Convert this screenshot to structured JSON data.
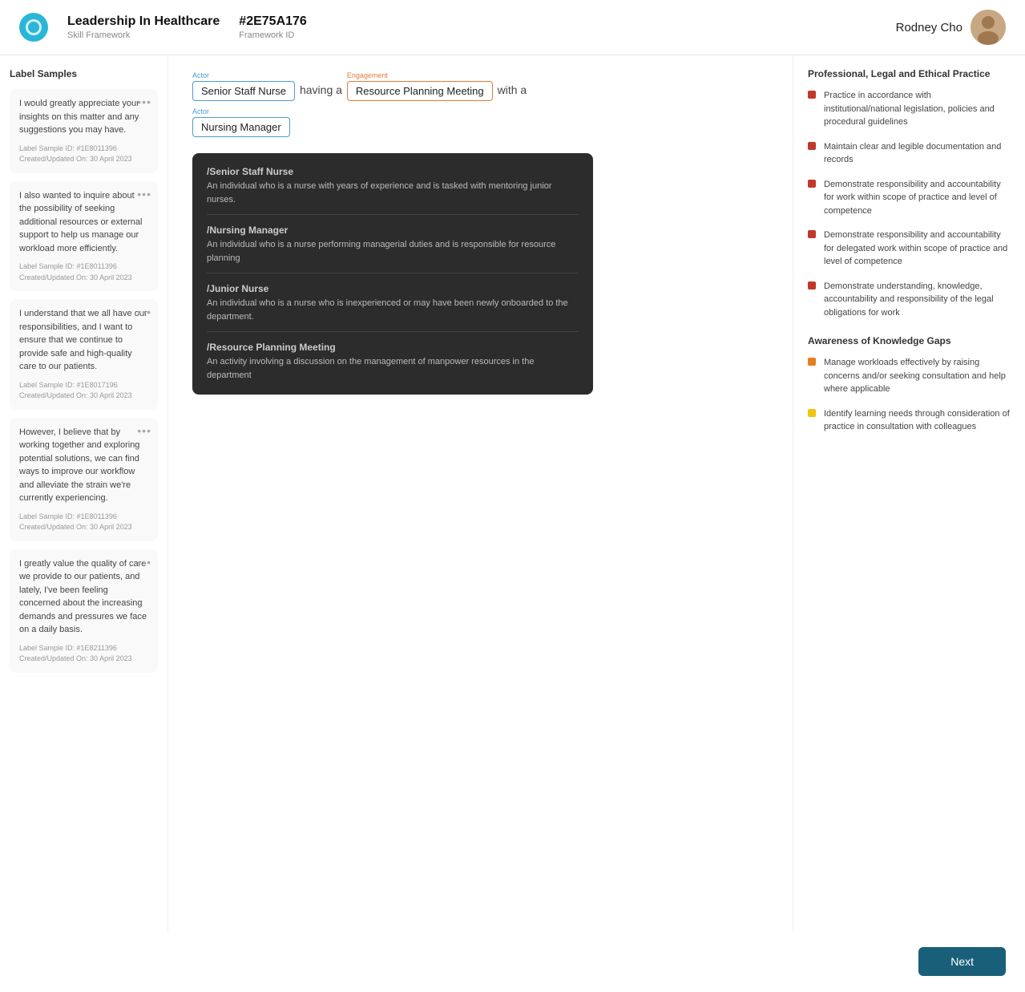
{
  "header": {
    "logo_alt": "Leadership In Healthcare logo",
    "title": "Leadership In Healthcare",
    "subtitle": "Skill Framework",
    "framework_id": "#2E75A176",
    "framework_id_label": "Framework ID",
    "username": "Rodney Cho"
  },
  "left_panel": {
    "section_title": "Label Samples",
    "samples": [
      {
        "text": "I would greatly appreciate your insights on this matter and any suggestions you may have.",
        "id_label": "Label Sample ID: #1E8011396",
        "created_label": "Created/Updated On: 30 April 2023"
      },
      {
        "text": "I also wanted to inquire about the possibility of seeking additional resources or external support to help us manage our workload more efficiently.",
        "id_label": "Label Sample ID: #1E8011396",
        "created_label": "Created/Updated On: 30 April 2023"
      },
      {
        "text": "I understand that we all have our responsibilities, and I want to ensure that we continue to provide safe and high-quality care to our patients.",
        "id_label": "Label Sample ID: #1E8017196",
        "created_label": "Created/Updated On: 30 April 2023"
      },
      {
        "text": "However, I believe that by working together and exploring potential solutions, we can find ways to improve our workflow and alleviate the strain we're currently experiencing.",
        "id_label": "Label Sample ID: #1E8011396",
        "created_label": "Created/Updated On: 30 April 2023"
      },
      {
        "text": "I greatly value the quality of care we provide to our patients, and lately, I've been feeling concerned about the increasing demands and pressures we face on a daily basis.",
        "id_label": "Label Sample ID: #1E8211396",
        "created_label": "Created/Updated On: 30 April 2023"
      }
    ]
  },
  "center_panel": {
    "tokens": [
      {
        "type": "actor_chip",
        "label": "Actor",
        "text": "Senior Staff Nurse"
      },
      {
        "type": "plain",
        "text": "having a"
      },
      {
        "type": "engagement_chip",
        "label": "Engagement",
        "text": "Resource Planning Meeting"
      },
      {
        "type": "plain",
        "text": "with a"
      }
    ],
    "tokens_row2": [
      {
        "type": "actor_chip",
        "label": "Actor",
        "text": "Nursing Manager"
      }
    ],
    "tooltip": {
      "items": [
        {
          "title": "/Senior Staff Nurse",
          "desc": "An individual who is a nurse with years of experience and is tasked with mentoring junior nurses."
        },
        {
          "title": "/Nursing Manager",
          "desc": "An individual who is a nurse performing managerial duties and is responsible for resource planning"
        },
        {
          "title": "/Junior Nurse",
          "desc": "An individual who is a nurse who is inexperienced or may have been newly onboarded to the department."
        },
        {
          "title": "/Resource Planning Meeting",
          "desc": "An activity involving a discussion on the management of manpower resources in the department"
        }
      ]
    }
  },
  "right_panel": {
    "section1_title": "Professional, Legal and Ethical Practice",
    "section1_items": [
      {
        "color": "#c0392b",
        "text": "Practice in accordance with institutional/national legislation, policies and procedural guidelines"
      },
      {
        "color": "#c0392b",
        "text": "Maintain clear and legible documentation and records"
      },
      {
        "color": "#c0392b",
        "text": "Demonstrate responsibility and accountability for work within scope of practice and level of competence"
      },
      {
        "color": "#c0392b",
        "text": "Demonstrate responsibility and accountability for delegated work within scope of practice and level of competence"
      },
      {
        "color": "#c0392b",
        "text": "Demonstrate understanding, knowledge, accountability and responsibility of the legal obligations for work"
      }
    ],
    "section2_title": "Awareness of Knowledge Gaps",
    "section2_items": [
      {
        "color": "#e67e22",
        "text": "Manage workloads effectively by raising concerns and/or seeking consultation and help where applicable"
      },
      {
        "color": "#f1c40f",
        "text": "Identify learning needs through consideration of practice in consultation with colleagues"
      }
    ]
  },
  "footer": {
    "next_label": "Next"
  }
}
